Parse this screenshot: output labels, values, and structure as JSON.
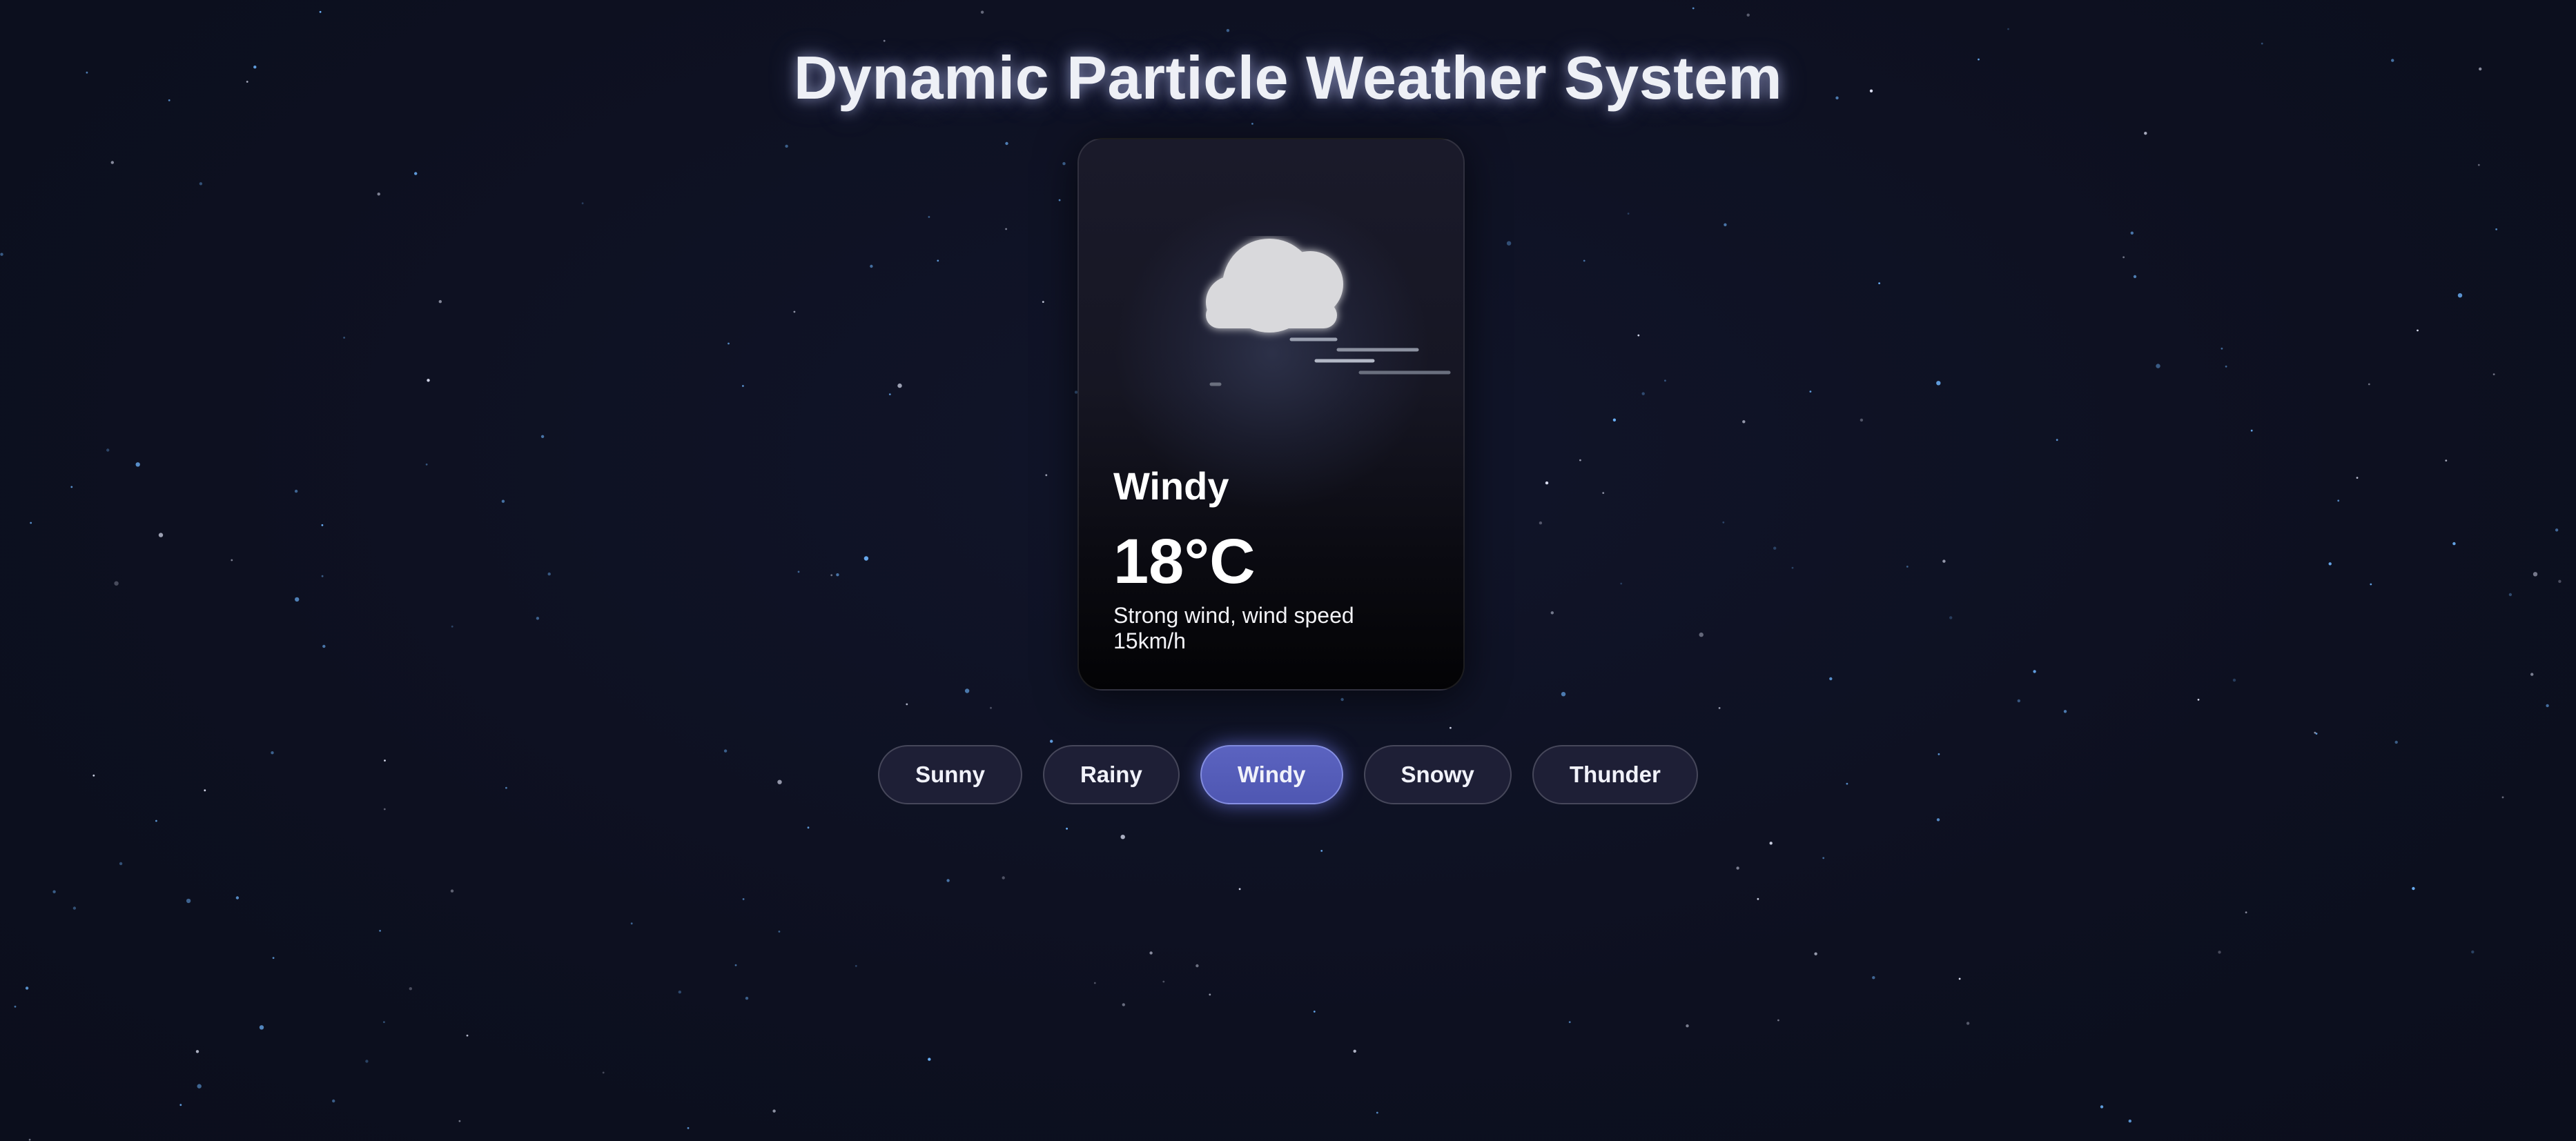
{
  "header": {
    "title": "Dynamic Particle Weather System"
  },
  "card": {
    "icon": "windy-cloud-icon",
    "condition": "Windy",
    "temperature": "18°C",
    "description": "Strong wind, wind speed 15km/h"
  },
  "controls": {
    "buttons": [
      {
        "label": "Sunny",
        "active": false
      },
      {
        "label": "Rainy",
        "active": false
      },
      {
        "label": "Windy",
        "active": true
      },
      {
        "label": "Snowy",
        "active": false
      },
      {
        "label": "Thunder",
        "active": false
      }
    ]
  },
  "colors": {
    "background": "#0d1020",
    "accent": "#5b63c0",
    "star_blue": "#6fb6ff",
    "star_white": "#e8ecff"
  }
}
